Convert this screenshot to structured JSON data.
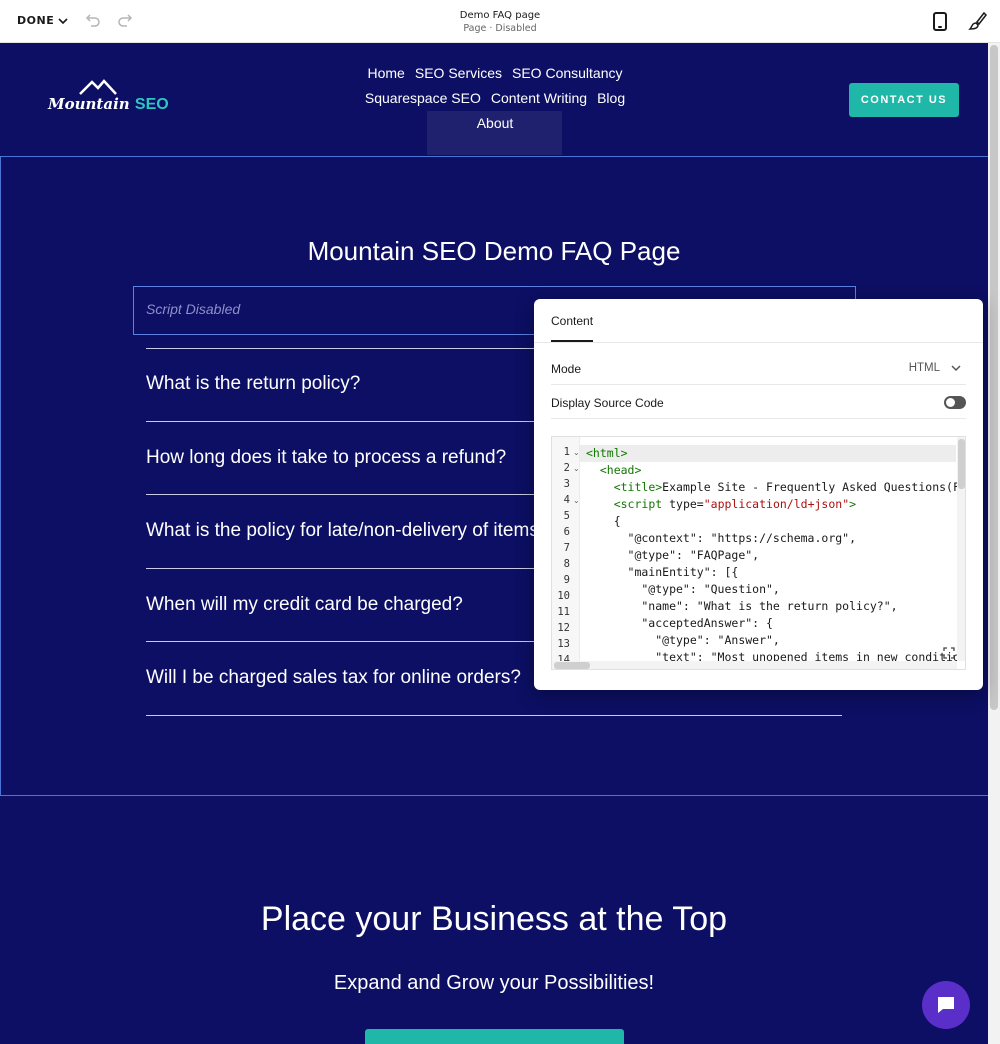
{
  "editor_bar": {
    "done_label": "DONE",
    "page_title": "Demo FAQ page",
    "page_status": "Page · Disabled",
    "icons": [
      "chevron-down-icon",
      "undo-icon",
      "redo-icon",
      "mobile-preview-icon",
      "design-brush-icon"
    ]
  },
  "site": {
    "logo_text_main": "Mountain",
    "logo_text_accent": "SEO",
    "nav": [
      "Home",
      "SEO Services",
      "SEO Consultancy",
      "Squarespace SEO",
      "Content Writing",
      "Blog",
      "About"
    ],
    "contact_label": "CONTACT US"
  },
  "faq_section": {
    "title": "Mountain SEO Demo FAQ Page",
    "script_placeholder": "Script Disabled",
    "questions": [
      "What is the return policy?",
      "How long does it take to process a refund?",
      "What is the policy for late/non-delivery of items o",
      "When will my credit card be charged?",
      "Will I be charged sales tax for online orders?"
    ]
  },
  "panel": {
    "tab": "Content",
    "mode_label": "Mode",
    "mode_value": "HTML",
    "display_source_label": "Display Source Code",
    "display_source_on": false,
    "code_line_numbers": [
      "1",
      "2",
      "3",
      "4",
      "5",
      "6",
      "7",
      "8",
      "9",
      "10",
      "11",
      "12",
      "13",
      "14"
    ]
  },
  "cta": {
    "title": "Place your Business at the Top",
    "subtitle": "Expand and Grow your Possibilities!"
  },
  "colors": {
    "site_background": "#0c0f63",
    "accent_teal": "#1fb8a8",
    "chat_purple": "#5a2fc9",
    "selection_blue": "#4a74d8"
  }
}
